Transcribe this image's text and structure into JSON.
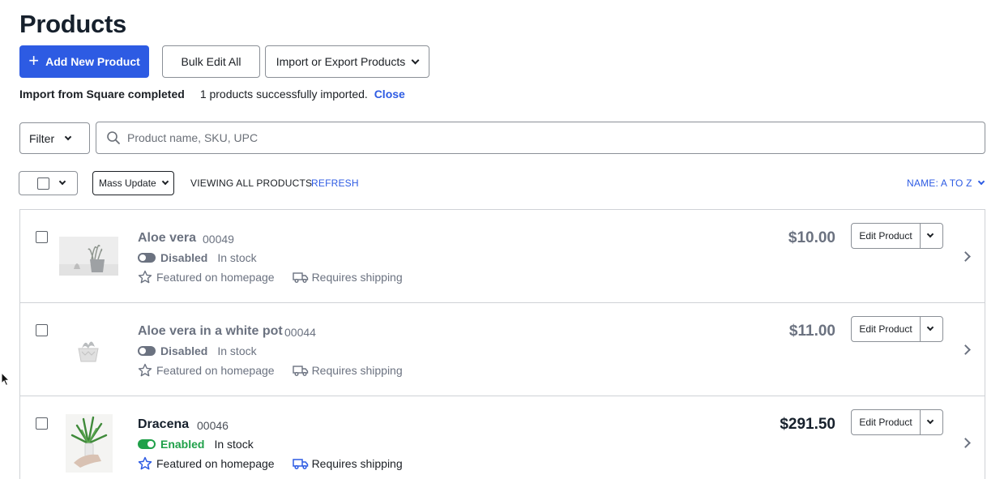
{
  "page": {
    "title": "Products"
  },
  "toolbar": {
    "add_label": "Add New Product",
    "bulk_label": "Bulk Edit All",
    "import_label": "Import or Export Products"
  },
  "notice": {
    "title": "Import from Square completed",
    "message": "1 products successfully imported.",
    "close_label": "Close"
  },
  "filter": {
    "label": "Filter"
  },
  "search": {
    "placeholder": "Product name, SKU, UPC",
    "value": ""
  },
  "list_controls": {
    "mass_update_label": "Mass Update",
    "viewing_label": "VIEWING ALL PRODUCTS",
    "refresh_label": "REFRESH",
    "sort_label": "NAME: A TO Z"
  },
  "products": [
    {
      "name": "Aloe vera",
      "sku": "00049",
      "status": "Disabled",
      "enabled": false,
      "stock": "In stock",
      "featured": "Featured on homepage",
      "shipping": "Requires shipping",
      "price": "$10.00",
      "edit_label": "Edit Product"
    },
    {
      "name": "Aloe vera in a white pot",
      "sku": "00044",
      "status": "Disabled",
      "enabled": false,
      "stock": "In stock",
      "featured": "Featured on homepage",
      "shipping": "Requires shipping",
      "price": "$11.00",
      "edit_label": "Edit Product"
    },
    {
      "name": "Dracena",
      "sku": "00046",
      "status": "Enabled",
      "enabled": true,
      "stock": "In stock",
      "featured": "Featured on homepage",
      "shipping": "Requires shipping",
      "price": "$291.50",
      "edit_label": "Edit Product"
    }
  ],
  "colors": {
    "accent": "#2d5be3",
    "enabled": "#1fa049",
    "muted": "#6b7280"
  }
}
